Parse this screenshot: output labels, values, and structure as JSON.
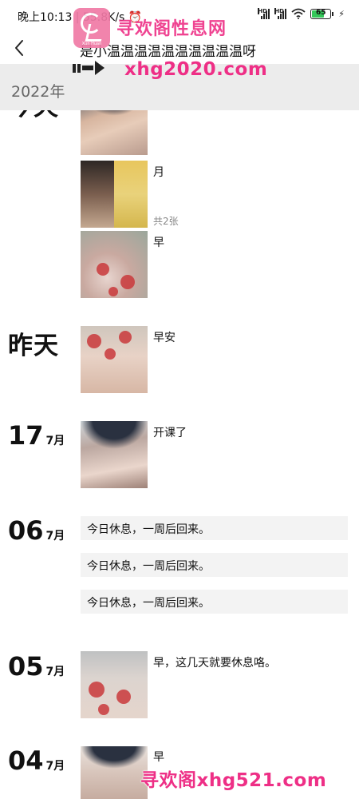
{
  "status_bar": {
    "time": "晚上10:13",
    "network_speed": "55.8K/s",
    "battery": "65",
    "icons": [
      "alarm-icon",
      "hd-signal-icon",
      "hd-signal-icon",
      "wifi-icon",
      "battery-icon",
      "charging-icon"
    ],
    "battery_color": "#34c759"
  },
  "header": {
    "back_icon": "chevron-left-icon",
    "title": "是小温温温温温温温温温温呀"
  },
  "year_bar": {
    "label": "2022年"
  },
  "watermark": {
    "top_text_cn": "寻欢阁性息网",
    "top_url": "xhg2020.com",
    "logo_text": "Xun Huan",
    "bottom_text": "寻欢阁xhg521.com",
    "color": "#ee2f86"
  },
  "feed": {
    "groups": [
      {
        "date_label": "今天",
        "posts": [
          {
            "text": "",
            "photo": "selfie-blue-hair-icon"
          },
          {
            "text": "月",
            "count": "共2张",
            "photo": "two-photo-collage-icon"
          },
          {
            "text": "早",
            "photo": "floral-dress-photo-icon"
          }
        ]
      },
      {
        "date_label": "昨天",
        "posts": [
          {
            "text": "早安",
            "photo": "floral-dress-photo-icon"
          }
        ]
      },
      {
        "day": "17",
        "month": "7月",
        "posts": [
          {
            "text": "开课了",
            "photo": "selfie-blue-hair-icon"
          }
        ]
      },
      {
        "day": "06",
        "month": "7月",
        "posts": [
          {
            "text": "今日休息，一周后回来。"
          },
          {
            "text": "今日休息，一周后回来。"
          },
          {
            "text": "今日休息，一周后回来。"
          }
        ]
      },
      {
        "day": "05",
        "month": "7月",
        "posts": [
          {
            "text": "早，这几天就要休息咯。",
            "photo": "floral-dress-photo-icon"
          }
        ]
      },
      {
        "day": "04",
        "month": "7月",
        "posts": [
          {
            "text": "早",
            "photo": "selfie-blue-hair-icon"
          }
        ]
      }
    ]
  }
}
